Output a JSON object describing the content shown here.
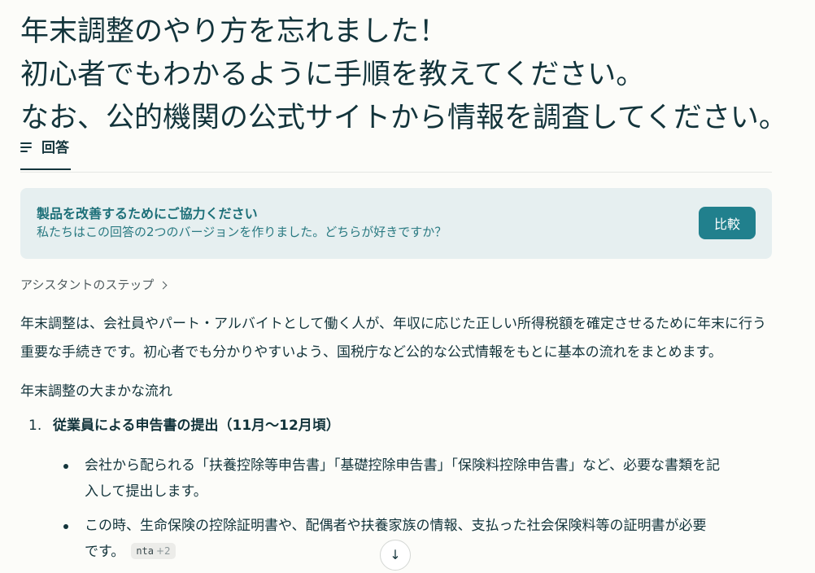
{
  "question": {
    "lines": [
      "年末調整のやり方を忘れました！",
      "初心者でもわかるように手順を教えてください。",
      "なお、公的機関の公式サイトから情報を調査してください。"
    ]
  },
  "tabs": [
    {
      "label": "回答",
      "icon": "list-icon",
      "active": true
    }
  ],
  "feedback": {
    "title": "製品を改善するためにご協力ください",
    "subtitle": "私たちはこの回答の2つのバージョンを作りました。どちらが好きですか？",
    "button_label": "比較"
  },
  "steps_label": "アシスタントのステップ",
  "answer": {
    "intro_lines": [
      "年末調整は、会社員やパート・アルバイトとして働く人が、年収に応じた正しい所得税額を確定させるために年末に行う",
      "重要な手続きです。初心者でも分かりやすいよう、国税庁など公的な公式情報をもとに基本の流れをまとめます。"
    ],
    "section_heading": "年末調整の大まかな流れ",
    "steps": [
      {
        "number": "1.",
        "title": "従業員による申告書の提出（11月〜12月頃）",
        "bullets": [
          {
            "lines": [
              "会社から配られる「扶養控除等申告書」「基礎控除申告書」「保険料控除申告書」など、必要な書類を記",
              "入して提出します。"
            ]
          },
          {
            "lines": [
              "この時、生命保険の控除証明書や、配偶者や扶養家族の情報、支払った社会保険料等の証明書が必要",
              "です。"
            ],
            "citation": {
              "source": "nta",
              "more": "+2"
            }
          }
        ]
      }
    ]
  },
  "scroll_button_icon": "arrow-down-icon"
}
